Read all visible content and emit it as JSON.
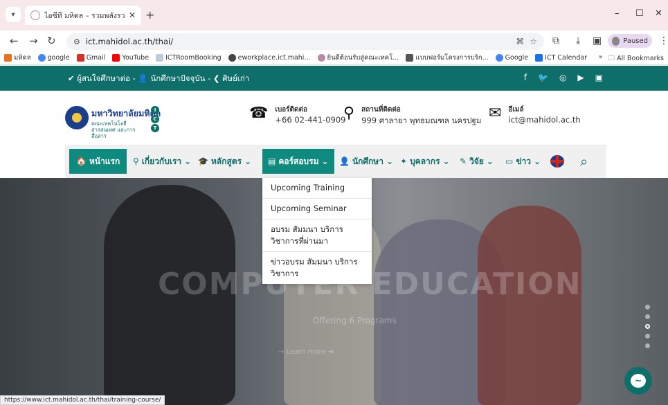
{
  "browser": {
    "tab_title": "ไอซีที มหิดล – รวมพลังรวมใจ ก้าวไกล...",
    "url": "ict.mahidol.ac.th/thai/",
    "profile_label": "Paused",
    "status_url": "https://www.ict.mahidol.ac.th/thai/training-course/",
    "bookmarks": [
      "มหิดล",
      "google",
      "Gmail",
      "YouTube",
      "ICTRoomBooking",
      "eworkplace.ict.mahi...",
      "ยินดีต้อนรับสู่คณะเทคโ...",
      "แบบฟอร์มโครงการบริก...",
      "Google",
      "ICT Calendar"
    ],
    "all_bookmarks": "All Bookmarks"
  },
  "site": {
    "top_links": "✔ ผู้สนใจศึกษาต่อ - 👤 นักศึกษาปัจจุบัน - ❮ ศิษย์เก่า",
    "social": [
      "f",
      "🐦",
      "◎",
      "▶",
      "▣"
    ],
    "logo_main": "มหาวิทยาลัยมหิดล",
    "logo_sub": "คณะเทคโนโลยีสารสนเทศ และการสื่อสาร",
    "contact": {
      "phone_label": "เบอร์ติดต่อ",
      "phone": "+66 02-441-0909",
      "location_label": "สถานที่ติดต่อ",
      "location": "999 ศาลายา พุทธมณฑล นครปฐม",
      "email_label": "อีเมล์",
      "email": "ict@mahidol.ac.th"
    },
    "nav": {
      "home": "หน้าแรก",
      "about": "เกี่ยวกับเรา",
      "programs": "หลักสูตร",
      "courses": "คอร์สอบรม",
      "students": "นักศึกษา",
      "staff": "บุคลากร",
      "research": "วิจัย",
      "news": "ข่าว"
    },
    "dropdown": [
      "Upcoming Training",
      "Upcoming Seminar",
      "อบรม สัมมนา บริการวิชาการที่ผ่านมา",
      "ข่าวอบรม สัมมนา บริการวิชาการ"
    ],
    "hero": {
      "title": "COMPUTER EDUCATION",
      "subtitle": "Offering 6 Programs",
      "button": "→ Learn more  ➔"
    }
  }
}
